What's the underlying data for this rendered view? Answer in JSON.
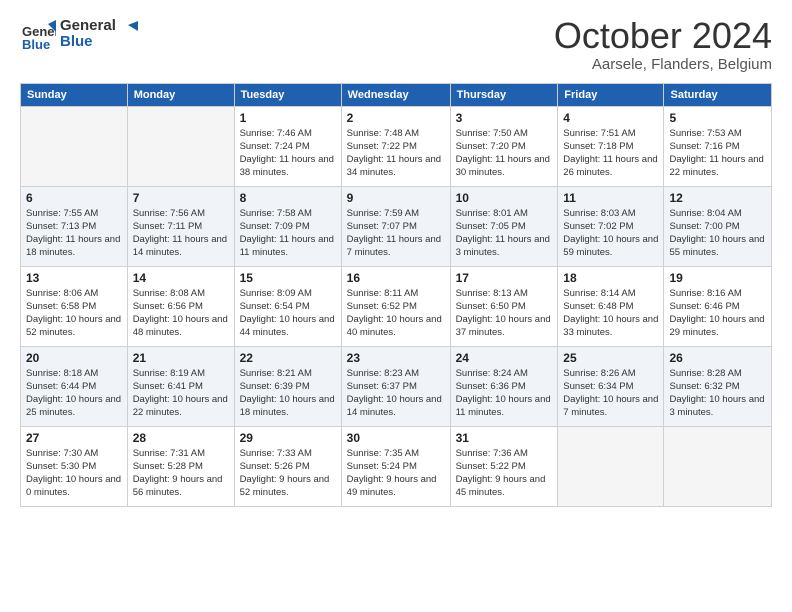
{
  "header": {
    "logo_line1": "General",
    "logo_line2": "Blue",
    "month": "October 2024",
    "location": "Aarsele, Flanders, Belgium"
  },
  "weekdays": [
    "Sunday",
    "Monday",
    "Tuesday",
    "Wednesday",
    "Thursday",
    "Friday",
    "Saturday"
  ],
  "weeks": [
    [
      {
        "day": "",
        "info": ""
      },
      {
        "day": "",
        "info": ""
      },
      {
        "day": "1",
        "info": "Sunrise: 7:46 AM\nSunset: 7:24 PM\nDaylight: 11 hours and 38 minutes."
      },
      {
        "day": "2",
        "info": "Sunrise: 7:48 AM\nSunset: 7:22 PM\nDaylight: 11 hours and 34 minutes."
      },
      {
        "day": "3",
        "info": "Sunrise: 7:50 AM\nSunset: 7:20 PM\nDaylight: 11 hours and 30 minutes."
      },
      {
        "day": "4",
        "info": "Sunrise: 7:51 AM\nSunset: 7:18 PM\nDaylight: 11 hours and 26 minutes."
      },
      {
        "day": "5",
        "info": "Sunrise: 7:53 AM\nSunset: 7:16 PM\nDaylight: 11 hours and 22 minutes."
      }
    ],
    [
      {
        "day": "6",
        "info": "Sunrise: 7:55 AM\nSunset: 7:13 PM\nDaylight: 11 hours and 18 minutes."
      },
      {
        "day": "7",
        "info": "Sunrise: 7:56 AM\nSunset: 7:11 PM\nDaylight: 11 hours and 14 minutes."
      },
      {
        "day": "8",
        "info": "Sunrise: 7:58 AM\nSunset: 7:09 PM\nDaylight: 11 hours and 11 minutes."
      },
      {
        "day": "9",
        "info": "Sunrise: 7:59 AM\nSunset: 7:07 PM\nDaylight: 11 hours and 7 minutes."
      },
      {
        "day": "10",
        "info": "Sunrise: 8:01 AM\nSunset: 7:05 PM\nDaylight: 11 hours and 3 minutes."
      },
      {
        "day": "11",
        "info": "Sunrise: 8:03 AM\nSunset: 7:02 PM\nDaylight: 10 hours and 59 minutes."
      },
      {
        "day": "12",
        "info": "Sunrise: 8:04 AM\nSunset: 7:00 PM\nDaylight: 10 hours and 55 minutes."
      }
    ],
    [
      {
        "day": "13",
        "info": "Sunrise: 8:06 AM\nSunset: 6:58 PM\nDaylight: 10 hours and 52 minutes."
      },
      {
        "day": "14",
        "info": "Sunrise: 8:08 AM\nSunset: 6:56 PM\nDaylight: 10 hours and 48 minutes."
      },
      {
        "day": "15",
        "info": "Sunrise: 8:09 AM\nSunset: 6:54 PM\nDaylight: 10 hours and 44 minutes."
      },
      {
        "day": "16",
        "info": "Sunrise: 8:11 AM\nSunset: 6:52 PM\nDaylight: 10 hours and 40 minutes."
      },
      {
        "day": "17",
        "info": "Sunrise: 8:13 AM\nSunset: 6:50 PM\nDaylight: 10 hours and 37 minutes."
      },
      {
        "day": "18",
        "info": "Sunrise: 8:14 AM\nSunset: 6:48 PM\nDaylight: 10 hours and 33 minutes."
      },
      {
        "day": "19",
        "info": "Sunrise: 8:16 AM\nSunset: 6:46 PM\nDaylight: 10 hours and 29 minutes."
      }
    ],
    [
      {
        "day": "20",
        "info": "Sunrise: 8:18 AM\nSunset: 6:44 PM\nDaylight: 10 hours and 25 minutes."
      },
      {
        "day": "21",
        "info": "Sunrise: 8:19 AM\nSunset: 6:41 PM\nDaylight: 10 hours and 22 minutes."
      },
      {
        "day": "22",
        "info": "Sunrise: 8:21 AM\nSunset: 6:39 PM\nDaylight: 10 hours and 18 minutes."
      },
      {
        "day": "23",
        "info": "Sunrise: 8:23 AM\nSunset: 6:37 PM\nDaylight: 10 hours and 14 minutes."
      },
      {
        "day": "24",
        "info": "Sunrise: 8:24 AM\nSunset: 6:36 PM\nDaylight: 10 hours and 11 minutes."
      },
      {
        "day": "25",
        "info": "Sunrise: 8:26 AM\nSunset: 6:34 PM\nDaylight: 10 hours and 7 minutes."
      },
      {
        "day": "26",
        "info": "Sunrise: 8:28 AM\nSunset: 6:32 PM\nDaylight: 10 hours and 3 minutes."
      }
    ],
    [
      {
        "day": "27",
        "info": "Sunrise: 7:30 AM\nSunset: 5:30 PM\nDaylight: 10 hours and 0 minutes."
      },
      {
        "day": "28",
        "info": "Sunrise: 7:31 AM\nSunset: 5:28 PM\nDaylight: 9 hours and 56 minutes."
      },
      {
        "day": "29",
        "info": "Sunrise: 7:33 AM\nSunset: 5:26 PM\nDaylight: 9 hours and 52 minutes."
      },
      {
        "day": "30",
        "info": "Sunrise: 7:35 AM\nSunset: 5:24 PM\nDaylight: 9 hours and 49 minutes."
      },
      {
        "day": "31",
        "info": "Sunrise: 7:36 AM\nSunset: 5:22 PM\nDaylight: 9 hours and 45 minutes."
      },
      {
        "day": "",
        "info": ""
      },
      {
        "day": "",
        "info": ""
      }
    ]
  ]
}
